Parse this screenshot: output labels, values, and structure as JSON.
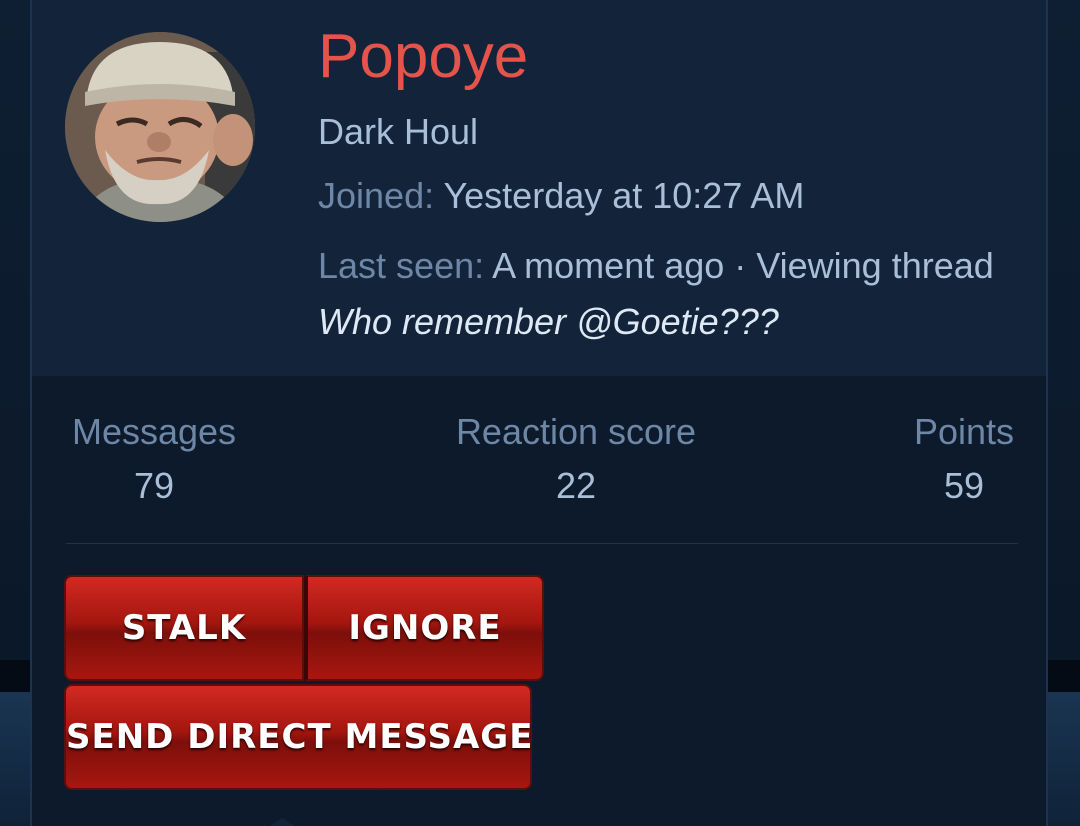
{
  "profile": {
    "username": "Popoye",
    "user_title": "Dark Houl",
    "avatar_icon": "user-avatar",
    "joined_label": "Joined:",
    "joined_value": "Yesterday at 10:27 AM",
    "last_seen_label": "Last seen:",
    "last_seen_value": "A moment ago · Viewing thread",
    "last_seen_thread": "Who remember @Goetie???"
  },
  "stats": [
    {
      "label": "Messages",
      "value": "79"
    },
    {
      "label": "Reaction score",
      "value": "22"
    },
    {
      "label": "Points",
      "value": "59"
    }
  ],
  "actions": {
    "stalk_label": "STALK",
    "ignore_label": "IGNORE",
    "dm_label": "SEND DIRECT MESSAGE"
  },
  "colors": {
    "username": "#e5534b",
    "button": "#a4160f",
    "header_bg": "#13243a",
    "body_bg": "#0c1a2b"
  }
}
